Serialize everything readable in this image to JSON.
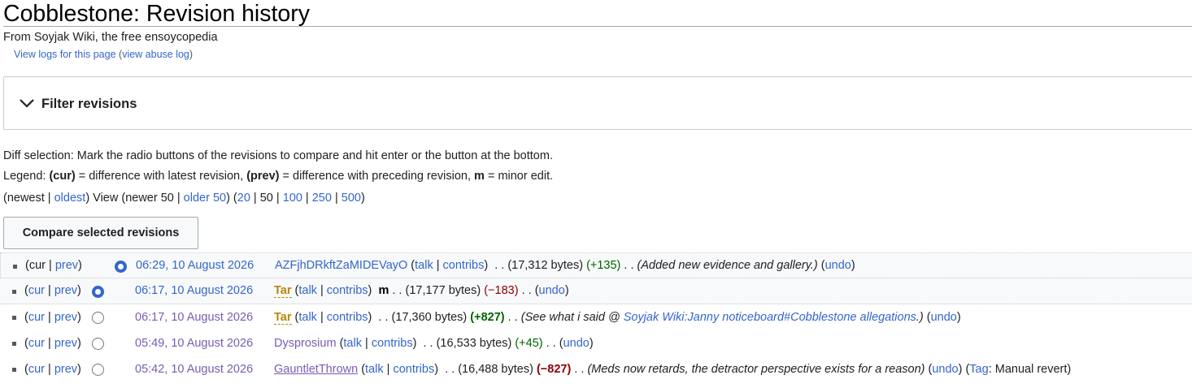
{
  "page": {
    "title": "Cobblestone: Revision history",
    "tagline": "From Soyjak Wiki, the free ensoycopedia",
    "logs_link": "View logs for this page",
    "abuse_open": " (",
    "abuse_link": "view abuse log",
    "abuse_close": ")"
  },
  "filter": {
    "label": "Filter revisions",
    "icon": "chevron-down-icon"
  },
  "diff_selection": {
    "line1": "Diff selection: Mark the radio buttons of the revisions to compare and hit enter or the button at the bottom.",
    "legend_prefix": "Legend: ",
    "cur_b": "(cur)",
    "cur_t": " = difference with latest revision, ",
    "prev_b": "(prev)",
    "prev_t": " = difference with preceding revision, ",
    "m_b": "m",
    "m_t": " = minor edit."
  },
  "nav": {
    "open": "(newest | ",
    "oldest": "oldest",
    "view": ") View (newer 50 | ",
    "older": "older 50",
    "mid": ") (",
    "n20": "20",
    "s1": " | 50 | ",
    "n100": "100",
    "s2": " | ",
    "n250": "250",
    "s3": " | ",
    "n500": "500",
    "close": ")"
  },
  "compare_button": "Compare selected revisions",
  "revisions": [
    {
      "cur": "cur",
      "prev": "prev",
      "date": "06:29, 10 August 2026",
      "user": "AZFjhDRkftZaMIDEVayO",
      "talk": "talk",
      "contribs": "contribs",
      "bytes": "(17,312 bytes)",
      "delta": "(+135)",
      "summary": "(Added new evidence and gallery.)",
      "undo": "undo"
    },
    {
      "cur": "cur",
      "prev": "prev",
      "date": "06:17, 10 August 2026",
      "user": "Tar",
      "talk": "talk",
      "contribs": "contribs",
      "minor": "m",
      "bytes": "(17,177 bytes)",
      "delta": "(−183)",
      "undo": "undo"
    },
    {
      "cur": "cur",
      "prev": "prev",
      "date": "06:17, 10 August 2026",
      "user": "Tar",
      "talk": "talk",
      "contribs": "contribs",
      "bytes": "(17,360 bytes)",
      "delta": "(+827)",
      "summary_pre": "(See what i said @ ",
      "summary_link": "Soyjak Wiki:Janny noticeboard#Cobblestone allegations",
      "summary_post": ".)",
      "undo": "undo"
    },
    {
      "cur": "cur",
      "prev": "prev",
      "date": "05:49, 10 August 2026",
      "user": "Dysprosium",
      "talk": "talk",
      "contribs": "contribs",
      "bytes": "(16,533 bytes)",
      "delta": "(+45)",
      "undo": "undo"
    },
    {
      "cur": "cur",
      "prev": "prev",
      "date": "05:42, 10 August 2026",
      "user": "GauntletThrown",
      "talk": "talk",
      "contribs": "contribs",
      "bytes": "(16,488 bytes)",
      "delta": "(−827)",
      "summary": "(Meds now retards, the detractor perspective exists for a reason)",
      "undo": "undo",
      "tag_label": "Tag",
      "tag_value": "Manual revert"
    }
  ]
}
